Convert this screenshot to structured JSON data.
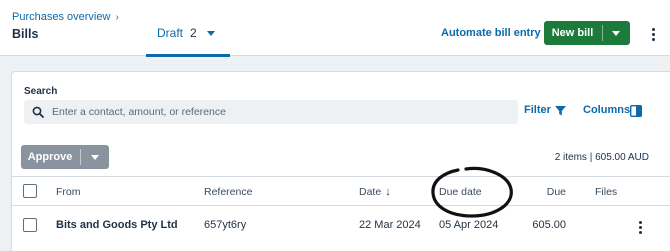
{
  "header": {
    "breadcrumb": "Purchases overview",
    "title": "Bills",
    "tab": {
      "label": "Draft",
      "count": "2"
    },
    "automate_link": "Automate bill entry",
    "new_bill_label": "New bill"
  },
  "search": {
    "label": "Search",
    "placeholder": "Enter a contact, amount, or reference",
    "value": ""
  },
  "toolbar": {
    "filter_label": "Filter",
    "columns_label": "Columns",
    "approve_label": "Approve"
  },
  "summary": "2 items | 605.00 AUD",
  "table": {
    "columns": [
      "From",
      "Reference",
      "Date",
      "Due date",
      "Due",
      "Files"
    ],
    "sorted_column": "Date",
    "sort_direction": "descending",
    "rows": [
      {
        "from": "Bits and Goods Pty Ltd",
        "reference": "657yt6ry",
        "date": "22 Mar 2024",
        "due_date": "05 Apr 2024",
        "due": "605.00",
        "files": ""
      }
    ]
  },
  "colors": {
    "accent": "#0d6aa8",
    "primary_button": "#1c7a3a",
    "disabled_button": "#8a949e",
    "background": "#eef1f4",
    "annotation_ink": "#111111"
  }
}
